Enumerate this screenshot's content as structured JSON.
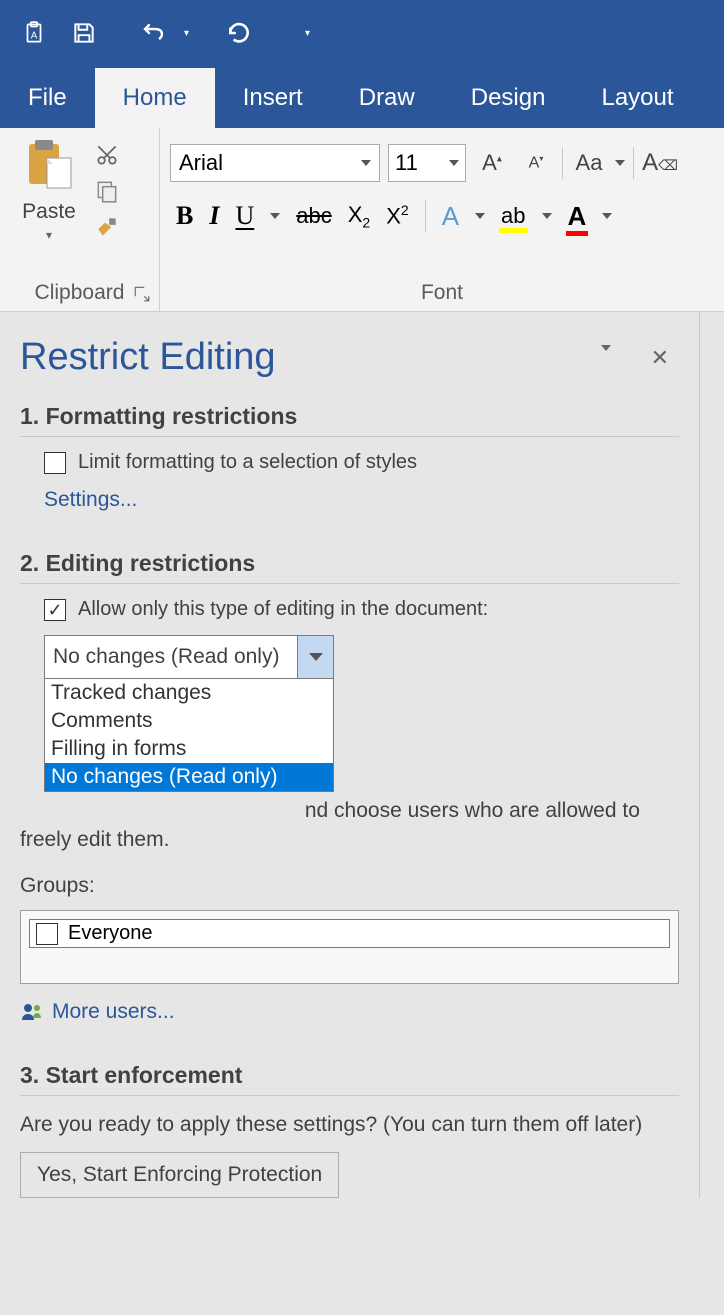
{
  "titlebar": {
    "icons": [
      "clipboard-a",
      "save",
      "undo",
      "redo",
      "customize"
    ]
  },
  "tabs": {
    "items": [
      "File",
      "Home",
      "Insert",
      "Draw",
      "Design",
      "Layout"
    ],
    "active": "Home"
  },
  "ribbon": {
    "clipboard": {
      "paste": "Paste",
      "group_label": "Clipboard"
    },
    "font": {
      "name": "Arial",
      "size": "11",
      "group_label": "Font"
    }
  },
  "pane": {
    "title": "Restrict Editing",
    "section1": {
      "heading": "1. Formatting restrictions",
      "checkbox_label": "Limit formatting to a selection of styles",
      "checked": false,
      "settings_link": "Settings..."
    },
    "section2": {
      "heading": "2. Editing restrictions",
      "checkbox_label": "Allow only this type of editing in the document:",
      "checked": true,
      "dropdown_value": "No changes (Read only)",
      "dropdown_options": [
        "Tracked changes",
        "Comments",
        "Filling in forms",
        "No changes (Read only)"
      ],
      "exceptions_text_partial": "nd choose users who are allowed to freely edit them.",
      "groups_label": "Groups:",
      "everyone_label": "Everyone",
      "more_users": "More users..."
    },
    "section3": {
      "heading": "3. Start enforcement",
      "prompt": "Are you ready to apply these settings? (You can turn them off later)",
      "button": "Yes, Start Enforcing Protection"
    }
  }
}
